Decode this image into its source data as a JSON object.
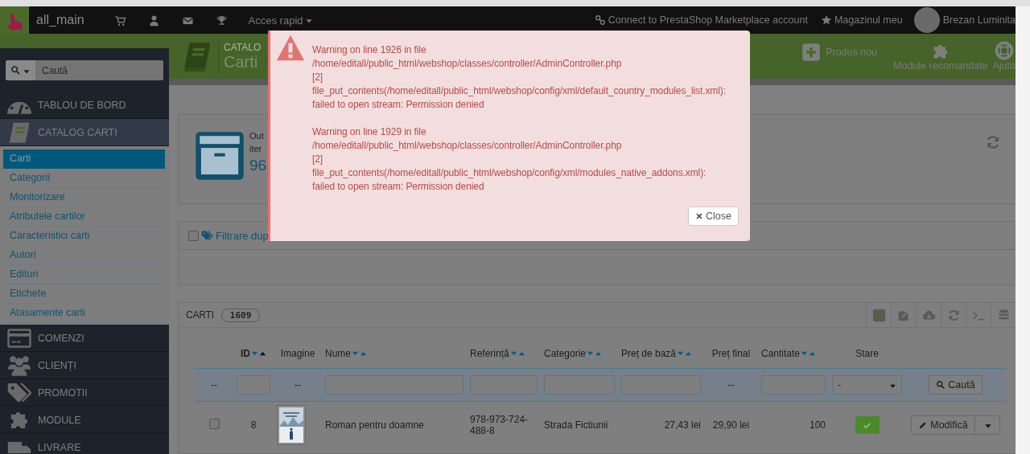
{
  "top_nav": {
    "brand": "all_main",
    "quick_access": "Acces rapid",
    "connect": "Connect to PrestaShop Marketplace account",
    "shop": "Magazinul meu",
    "user": "Brezan Luminita"
  },
  "header": {
    "breadcrumb": "CATALO",
    "title": "Carti",
    "toolbar": [
      {
        "kind": "add",
        "label": "Produs nou"
      },
      {
        "kind": "modules",
        "label": "Module recomandate"
      },
      {
        "kind": "help",
        "label": "Ajuto"
      }
    ]
  },
  "sidebar": {
    "search": {
      "placeholder": "Caută"
    },
    "items": [
      {
        "kind": "dashboard",
        "label": "TABLOU DE BORD",
        "expanded": false
      },
      {
        "kind": "catalog",
        "label": "CATALOG CARTI",
        "expanded": true,
        "children": [
          {
            "label": "Carti",
            "selected": true
          },
          {
            "label": "Categorii",
            "selected": false
          },
          {
            "label": "Monitorizare",
            "selected": false
          },
          {
            "label": "Atributele cartilor",
            "selected": false
          },
          {
            "label": "Caracteristici carti",
            "selected": false
          },
          {
            "label": "Autori",
            "selected": false
          },
          {
            "label": "Edituri",
            "selected": false
          },
          {
            "label": "Etichete",
            "selected": false
          },
          {
            "label": "Atasamente carti",
            "selected": false
          }
        ]
      },
      {
        "kind": "orders",
        "label": "COMENZI",
        "expanded": false
      },
      {
        "kind": "customers",
        "label": "CLIENȚI",
        "expanded": false
      },
      {
        "kind": "promo",
        "label": "PROMOTII",
        "expanded": false
      },
      {
        "kind": "modules",
        "label": "MODULE",
        "expanded": false
      },
      {
        "kind": "shipping",
        "label": "LIVRARE",
        "expanded": false
      }
    ]
  },
  "kpi": {
    "line_1": "Out",
    "line_2": "iter",
    "value": "96"
  },
  "filter": {
    "label": "Filtrare dup",
    "checked": false
  },
  "table": {
    "title": "CARTI",
    "count": "1609",
    "columns": [
      {
        "label": "ID",
        "sortable": true,
        "sorted_ascending": true
      },
      {
        "label": "Imagine",
        "sortable": false
      },
      {
        "label": "Nume",
        "sortable": true,
        "sorted_ascending": false
      },
      {
        "label": "Referință",
        "sortable": true,
        "sorted_ascending": false
      },
      {
        "label": "Categorie",
        "sortable": true,
        "sorted_ascending": false
      },
      {
        "label": "Preț de bază",
        "sortable": true,
        "sorted_ascending": false
      },
      {
        "label": "Preț final",
        "sortable": false
      },
      {
        "label": "Cantitate",
        "sortable": true,
        "sorted_ascending": false
      },
      {
        "label": "Stare",
        "sortable": false
      }
    ],
    "filters": [
      {
        "kind": "text",
        "text": "--"
      },
      {
        "kind": "input"
      },
      {
        "kind": "text",
        "text": "--"
      },
      {
        "kind": "input"
      },
      {
        "kind": "input"
      },
      {
        "kind": "input"
      },
      {
        "kind": "input"
      },
      {
        "kind": "text",
        "text": "--"
      },
      {
        "kind": "input"
      },
      {
        "kind": "select",
        "value": "-"
      },
      {
        "kind": "button",
        "label": "Caută"
      }
    ],
    "rows": [
      {
        "checked": false,
        "id": "8",
        "name": "Roman pentru doamne",
        "reference": "978-973-724-488-8",
        "category": "Strada Fictiunii",
        "base_price": "27,43 lei",
        "final_price": "29,90 lei",
        "quantity": "100",
        "active": true,
        "action": "Modifică"
      }
    ]
  },
  "modal": {
    "messages": [
      {
        "lines": [
          "Warning on line 1926 in file",
          "/home/editall/public_html/webshop/classes/controller/AdminController.php",
          "[2]",
          "file_put_contents(/home/editall/public_html/webshop/config/xml/default_country_modules_list.xml):",
          "failed to open stream: Permission denied"
        ]
      },
      {
        "lines": [
          "Warning on line 1929 in file",
          "/home/editall/public_html/webshop/classes/controller/AdminController.php",
          "[2]",
          "file_put_contents(/home/editall/public_html/webshop/config/xml/modules_native_addons.xml):",
          "failed to open stream: Permission denied"
        ]
      }
    ],
    "close": "Close"
  }
}
